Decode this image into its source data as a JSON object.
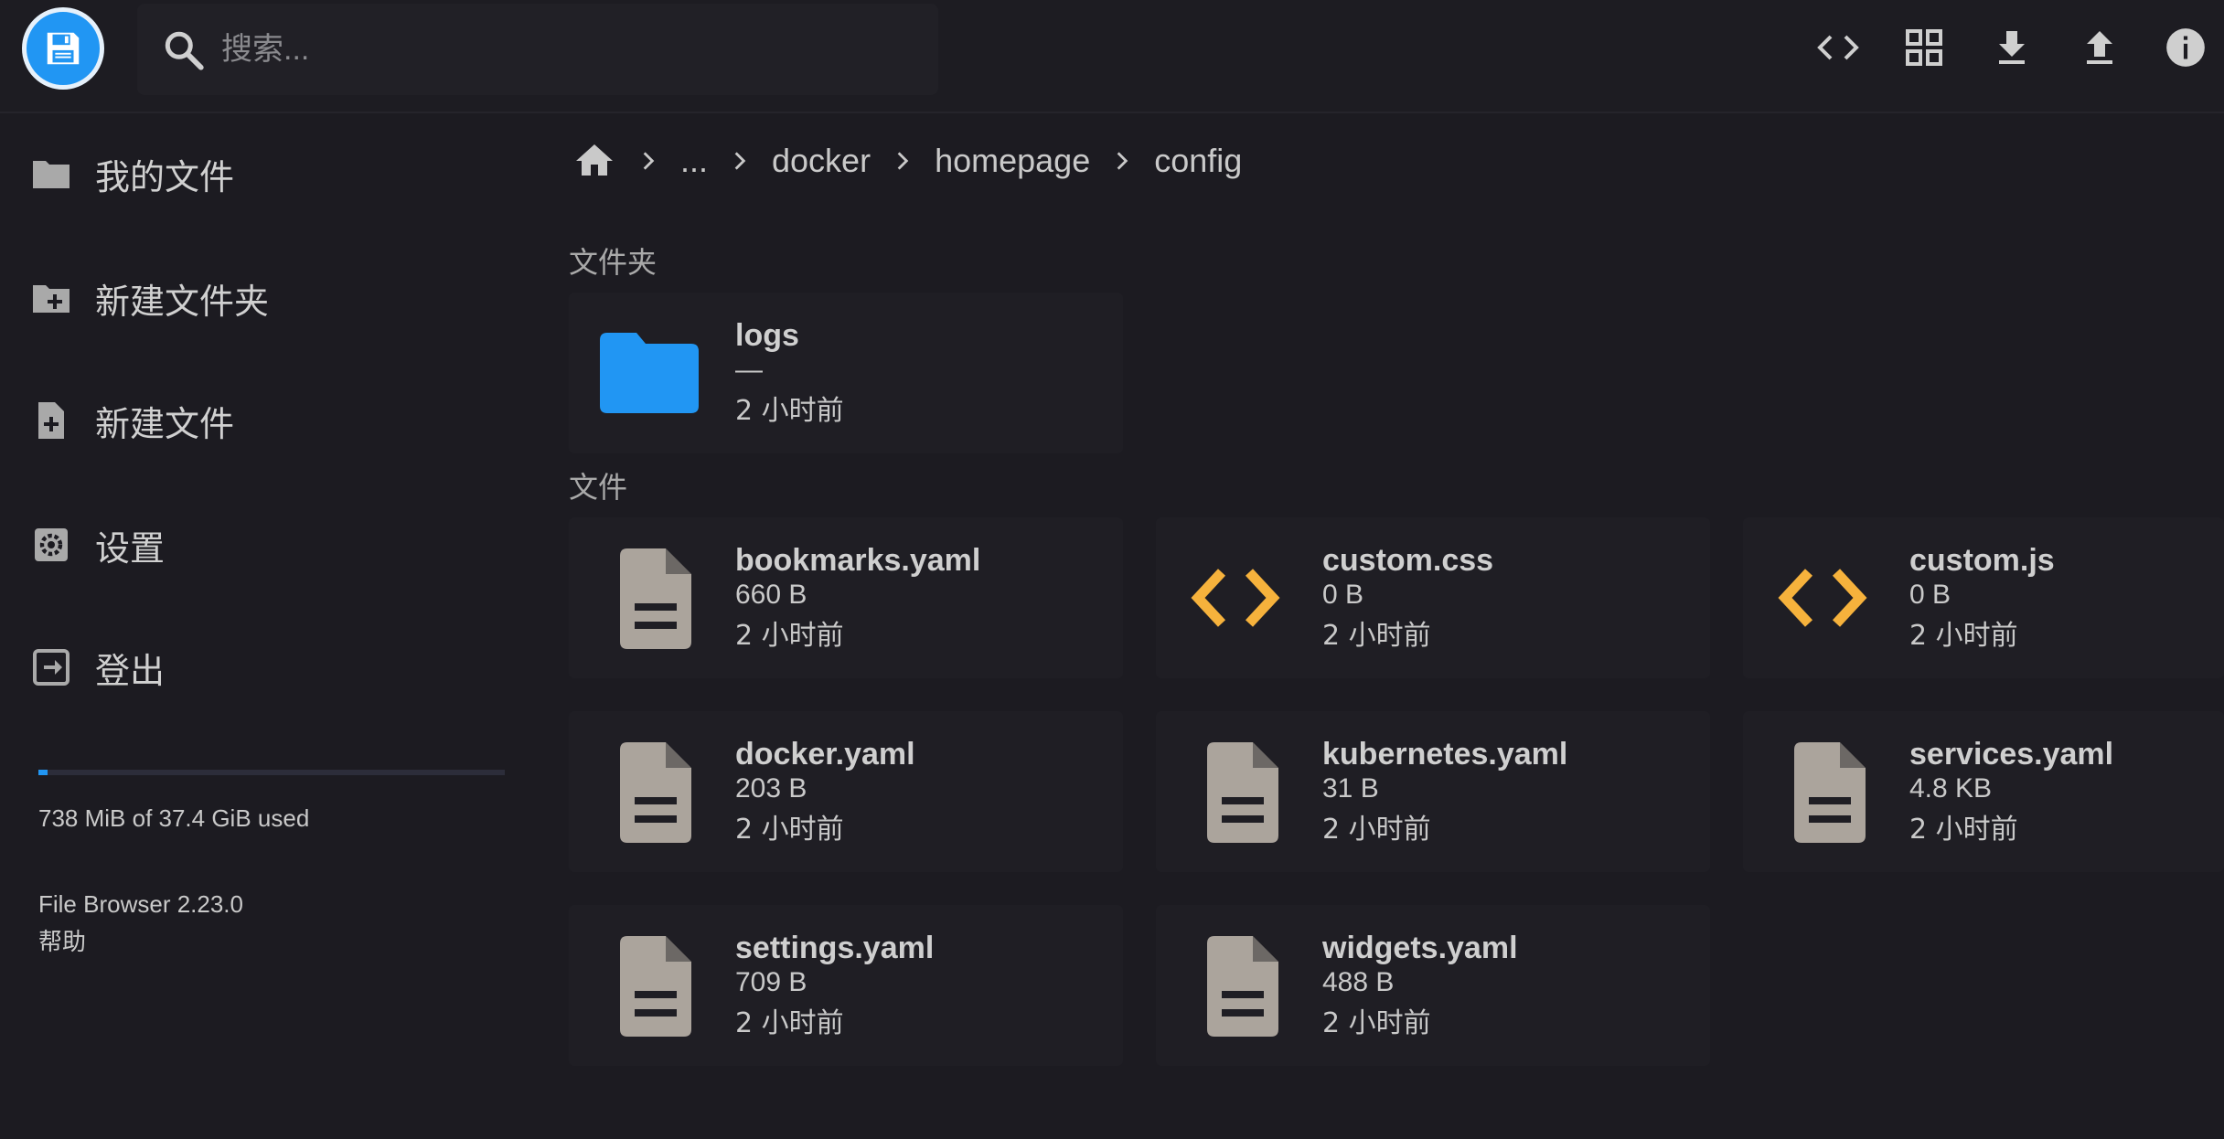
{
  "header": {
    "search_placeholder": "搜索...",
    "buttons": [
      "code-view",
      "grid-view",
      "download",
      "upload",
      "info"
    ]
  },
  "sidebar": {
    "items": [
      {
        "label": "我的文件",
        "icon": "folder-icon"
      },
      {
        "label": "新建文件夹",
        "icon": "new-folder-icon"
      },
      {
        "label": "新建文件",
        "icon": "new-file-icon"
      },
      {
        "label": "设置",
        "icon": "settings-icon"
      },
      {
        "label": "登出",
        "icon": "logout-icon"
      }
    ],
    "usage_text": "738 MiB of 37.4 GiB used",
    "usage_fraction": 0.019,
    "version": "File Browser 2.23.0",
    "help": "帮助"
  },
  "breadcrumbs": [
    "...",
    "docker",
    "homepage",
    "config"
  ],
  "sections": {
    "folders_title": "文件夹",
    "files_title": "文件"
  },
  "folders": [
    {
      "name": "logs",
      "size": "—",
      "time": "2 小时前"
    }
  ],
  "files": [
    {
      "name": "bookmarks.yaml",
      "size": "660 B",
      "time": "2 小时前",
      "type": "document"
    },
    {
      "name": "custom.css",
      "size": "0 B",
      "time": "2 小时前",
      "type": "code"
    },
    {
      "name": "custom.js",
      "size": "0 B",
      "time": "2 小时前",
      "type": "code"
    },
    {
      "name": "docker.yaml",
      "size": "203 B",
      "time": "2 小时前",
      "type": "document"
    },
    {
      "name": "kubernetes.yaml",
      "size": "31 B",
      "time": "2 小时前",
      "type": "document"
    },
    {
      "name": "services.yaml",
      "size": "4.8 KB",
      "time": "2 小时前",
      "type": "document"
    },
    {
      "name": "settings.yaml",
      "size": "709 B",
      "time": "2 小时前",
      "type": "document"
    },
    {
      "name": "widgets.yaml",
      "size": "488 B",
      "time": "2 小时前",
      "type": "document"
    }
  ],
  "colors": {
    "accent": "#2196f3",
    "code_icon": "#f6b23c",
    "doc_icon": "#aba49c",
    "background": "#1c1b21"
  }
}
